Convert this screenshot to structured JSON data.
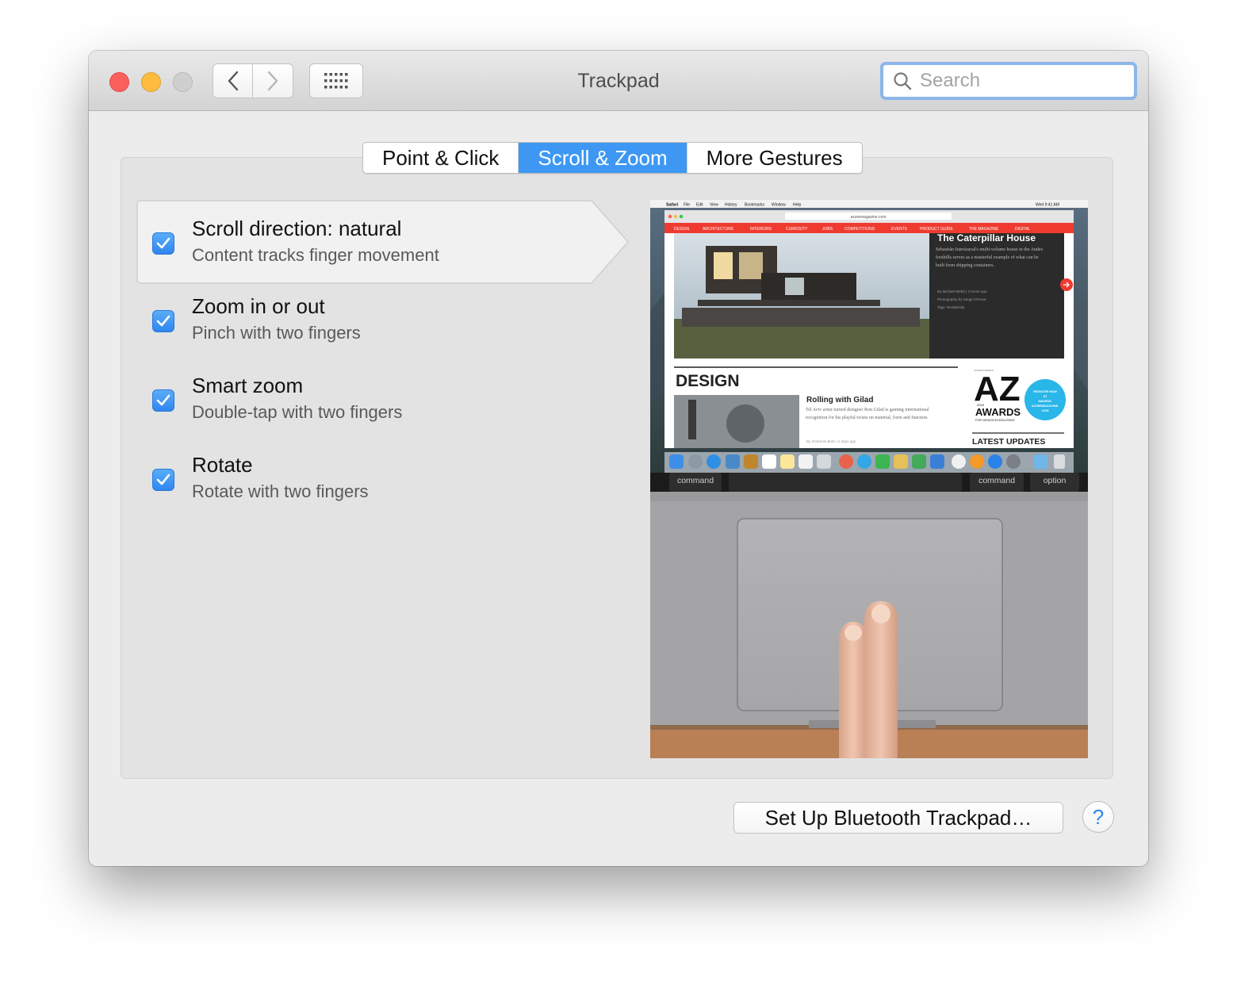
{
  "window": {
    "title": "Trackpad"
  },
  "search": {
    "placeholder": "Search"
  },
  "tabs": [
    {
      "label": "Point & Click",
      "active": false
    },
    {
      "label": "Scroll & Zoom",
      "active": true
    },
    {
      "label": "More Gestures",
      "active": false
    }
  ],
  "options": [
    {
      "title": "Scroll direction: natural",
      "subtitle": "Content tracks finger movement",
      "checked": true,
      "selected": true
    },
    {
      "title": "Zoom in or out",
      "subtitle": "Pinch with two fingers",
      "checked": true,
      "selected": false
    },
    {
      "title": "Smart zoom",
      "subtitle": "Double-tap with two fingers",
      "checked": true,
      "selected": false
    },
    {
      "title": "Rotate",
      "subtitle": "Rotate with two fingers",
      "checked": true,
      "selected": false
    }
  ],
  "preview": {
    "menubar": {
      "app": "Safari",
      "items": [
        "File",
        "Edit",
        "View",
        "History",
        "Bookmarks",
        "Window",
        "Help"
      ],
      "clock": "Wed 9:41 AM"
    },
    "url": "azuremagazine.com",
    "site_nav": [
      "DESIGN",
      "ARCHITECTURE",
      "INTERIORS",
      "CURIOSITY",
      "JOBS",
      "COMPETITIONS",
      "EVENTS",
      "PRODUCT GUIDE",
      "THE MAGAZINE",
      "DIGITAL"
    ],
    "hero": {
      "headline": "The Caterpillar House",
      "body": "Sebastián Irarrázaval's multi-volume house in the Andes foothills serves as a masterful example of what can be built from shipping containers.",
      "byline": "By Michael Webb | 2 hours ago",
      "photo_credit": "Photography by Sergio Pirrone",
      "tags": "Tags: Residential"
    },
    "section": "DESIGN",
    "article": {
      "title": "Rolling with Gilad",
      "body": "Tel Aviv artist turned designer Ron Gilad is gaining international recognition for his playful twists on material, form and function.",
      "byline": "By Kimberlie Birks | 4 days ago"
    },
    "ad": {
      "label": "ADVERTISEMENT",
      "logo": "AZ",
      "year": "2015",
      "awards": "AWARDS",
      "tagline": "FOR DESIGN EXCELLENCE",
      "badge_lines": [
        "REGISTER NOW",
        "AT",
        "AWARDS.",
        "AZUREMAGAZINE.",
        "COM"
      ]
    },
    "latest": "LATEST UPDATES",
    "keys": [
      "command",
      "command",
      "option"
    ]
  },
  "buttons": {
    "bluetooth": "Set Up Bluetooth Trackpad…",
    "help": "?"
  },
  "colors": {
    "accent": "#3e98f3",
    "site_red": "#ef3b2f",
    "badge_cyan": "#29b6e8"
  }
}
